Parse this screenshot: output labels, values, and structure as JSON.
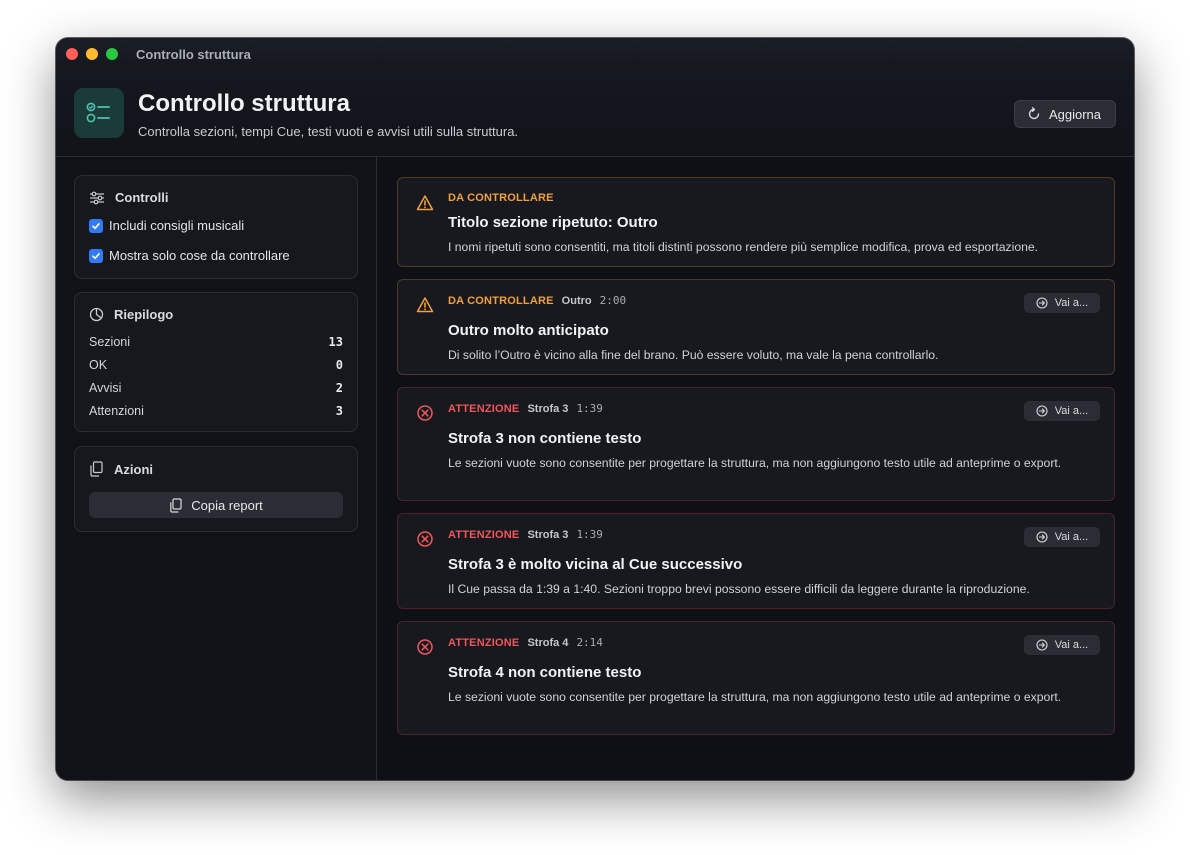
{
  "window": {
    "title": "Controllo struttura"
  },
  "header": {
    "title": "Controllo struttura",
    "subtitle": "Controlla sezioni, tempi Cue, testi vuoti e avvisi utili sulla struttura.",
    "refresh_label": "Aggiorna"
  },
  "controls": {
    "title": "Controlli",
    "options": [
      {
        "label": "Includi consigli musicali",
        "checked": true
      },
      {
        "label": "Mostra solo cose da controllare",
        "checked": true
      }
    ]
  },
  "summary": {
    "title": "Riepilogo",
    "rows": [
      {
        "label": "Sezioni",
        "value": "13"
      },
      {
        "label": "OK",
        "value": "0"
      },
      {
        "label": "Avvisi",
        "value": "2"
      },
      {
        "label": "Attenzioni",
        "value": "3"
      }
    ]
  },
  "actions": {
    "title": "Azioni",
    "copy_label": "Copia report"
  },
  "colors": {
    "warning": "#f0a040",
    "error": "#f0565d",
    "accent": "#2f7bf5",
    "teal": "#4fc3b0"
  },
  "issues": [
    {
      "severity": "DA CONTROLLARE",
      "kind": "warning",
      "section": "",
      "time": "",
      "title": "Titolo sezione ripetuto: Outro",
      "description": "I nomi ripetuti sono consentiti, ma titoli distinti possono rendere più semplice modifica, prova ed esportazione.",
      "go_label": ""
    },
    {
      "severity": "DA CONTROLLARE",
      "kind": "warning",
      "section": "Outro",
      "time": "2:00",
      "title": "Outro molto anticipato",
      "description": "Di solito l’Outro è vicino alla fine del brano. Può essere voluto, ma vale la pena controllarlo.",
      "go_label": "Vai a..."
    },
    {
      "severity": "ATTENZIONE",
      "kind": "error",
      "section": "Strofa 3",
      "time": "1:39",
      "title": "Strofa 3 non contiene testo",
      "description": "Le sezioni vuote sono consentite per progettare la struttura, ma non aggiungono testo utile ad anteprime o export.",
      "go_label": "Vai a..."
    },
    {
      "severity": "ATTENZIONE",
      "kind": "error",
      "section": "Strofa 3",
      "time": "1:39",
      "title": "Strofa 3 è molto vicina al Cue successivo",
      "description": "Il Cue passa da 1:39 a 1:40. Sezioni troppo brevi possono essere difficili da leggere durante la riproduzione.",
      "go_label": "Vai a..."
    },
    {
      "severity": "ATTENZIONE",
      "kind": "error",
      "section": "Strofa 4",
      "time": "2:14",
      "title": "Strofa 4 non contiene testo",
      "description": "Le sezioni vuote sono consentite per progettare la struttura, ma non aggiungono testo utile ad anteprime o export.",
      "go_label": "Vai a..."
    }
  ]
}
